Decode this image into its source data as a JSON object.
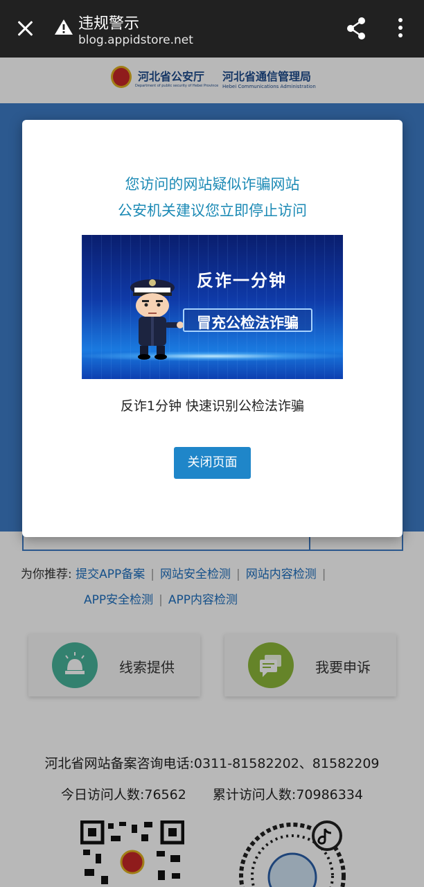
{
  "browser": {
    "title": "违规警示",
    "url": "blog.appidstore.net",
    "icons": [
      "close-icon",
      "warning-icon",
      "share-icon",
      "more-vert-icon"
    ]
  },
  "header": {
    "org1": "河北省公安厅",
    "org1_sub": "Department of public security of Hebei Province",
    "org2": "河北省通信管理局",
    "org2_sub": "Hebei Communications Administration"
  },
  "recommend": {
    "label": "为你推荐:",
    "links": [
      "提交APP备案",
      "网站安全检测",
      "网站内容检测",
      "APP安全检测",
      "APP内容检测"
    ]
  },
  "cards": [
    {
      "label": "线索提供",
      "icon": "alarm-light-icon",
      "color": "#47b39a"
    },
    {
      "label": "我要申诉",
      "icon": "chat-icon",
      "color": "#8cb83a"
    }
  ],
  "footer": {
    "phone": "河北省网站备案咨询电话:0311-81582202、81582209",
    "today_label": "今日访问人数:",
    "today_value": "76562",
    "total_label": "累计访问人数:",
    "total_value": "70986334"
  },
  "modal": {
    "warning_line1": "您访问的网站疑似诈骗网站",
    "warning_line2": "公安机关建议您立即停止访问",
    "banner_title": "反诈一分钟",
    "banner_subtitle": "冒充公检法诈骗",
    "caption": "反诈1分钟 快速识别公检法诈骗",
    "close_button": "关闭页面"
  },
  "colors": {
    "topbar": "#212121",
    "accent": "#1c8ab5",
    "button": "#1f86c9",
    "hero": "#3d7cc6",
    "link": "#1e70bf"
  }
}
